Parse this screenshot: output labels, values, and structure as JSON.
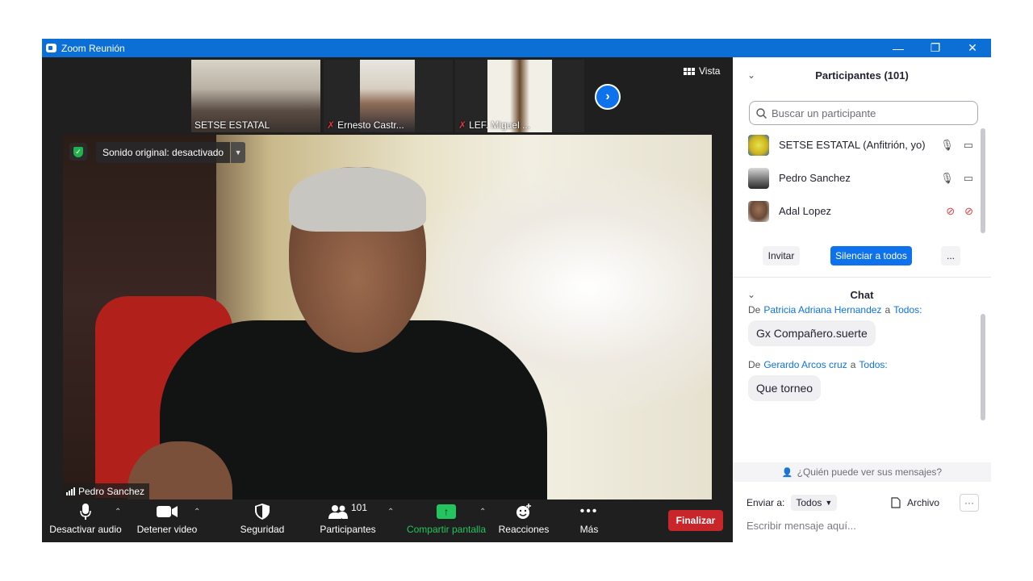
{
  "window": {
    "title": "Zoom Reunión",
    "controls": {
      "minimize": "—",
      "restore": "❐",
      "close": "✕"
    }
  },
  "gallery": {
    "thumbnails": [
      {
        "name": "SETSE ESTATAL",
        "muted": false
      },
      {
        "name": "Ernesto Castr...",
        "muted": true
      },
      {
        "name": "LEF. Miguel ...",
        "muted": true
      }
    ],
    "view_label": "Vista"
  },
  "main_video": {
    "speaker": "Pedro Sanchez",
    "sound_label": "Sonido original: desactivado"
  },
  "toolbar": {
    "audio_label": "Desactivar audio",
    "video_label": "Detener video",
    "security_label": "Seguridad",
    "participants_label": "Participantes",
    "participants_count": "101",
    "share_label": "Compartir pantalla",
    "reactions_label": "Reacciones",
    "more_label": "Más",
    "end_label": "Finalizar"
  },
  "participants": {
    "header": "Participantes (101)",
    "search_placeholder": "Buscar un participante",
    "list": [
      {
        "name": "SETSE ESTATAL (Anfitrión, yo)",
        "muted": false
      },
      {
        "name": "Pedro Sanchez",
        "muted": false
      },
      {
        "name": "Adal Lopez",
        "muted": true
      }
    ],
    "invite_label": "Invitar",
    "mute_all_label": "Silenciar a todos",
    "more_label": "..."
  },
  "chat": {
    "header": "Chat",
    "messages": [
      {
        "prefix": "De",
        "from": "Patricia Adriana Hernandez",
        "mid": "a",
        "to": "Todos:",
        "text": "Gx Compañero.suerte"
      },
      {
        "prefix": "De",
        "from": "Gerardo Arcos cruz",
        "mid": "a",
        "to": "Todos:",
        "text": "Que torneo"
      }
    ],
    "who_sees": "¿Quién puede ver sus mensajes?",
    "send_to_label": "Enviar a:",
    "send_to_value": "Todos",
    "file_label": "Archivo",
    "input_placeholder": "Escribir mensaje aquí..."
  },
  "colors": {
    "titlebar": "#0b6fd6",
    "accent_blue": "#0e72ed",
    "share_green": "#22c55e",
    "end_red": "#c8262b",
    "mute_red": "#e0393e"
  }
}
